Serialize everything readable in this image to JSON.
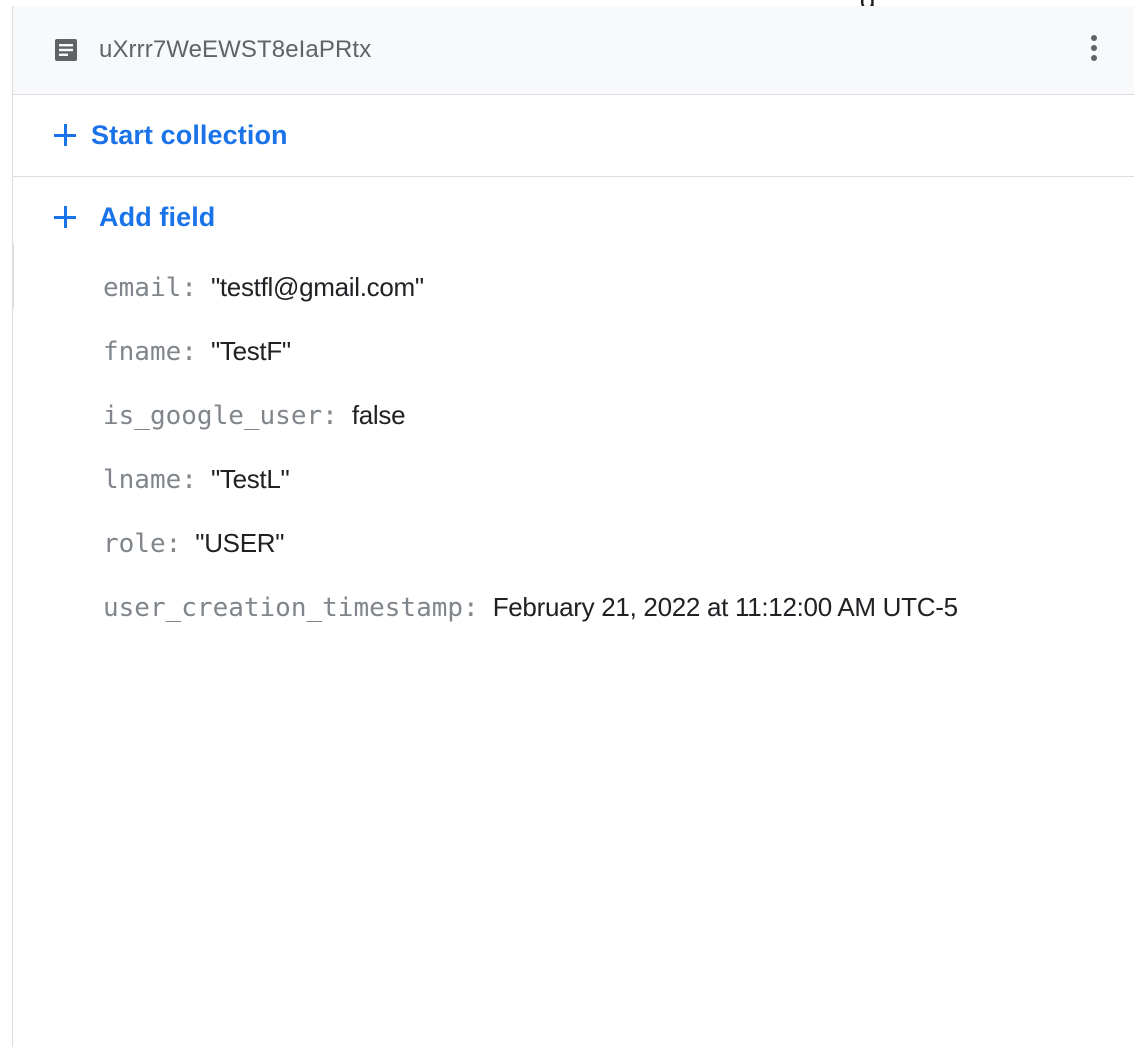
{
  "document": {
    "id": "uXrrr7WeEWST8eIaPRtx"
  },
  "actions": {
    "start_collection": "Start collection",
    "add_field": "Add field"
  },
  "fields": [
    {
      "key": "email",
      "value": "\"testfl@gmail.com\""
    },
    {
      "key": "fname",
      "value": "\"TestF\""
    },
    {
      "key": "is_google_user",
      "value": "false"
    },
    {
      "key": "lname",
      "value": "\"TestL\""
    },
    {
      "key": "role",
      "value": "\"USER\""
    },
    {
      "key": "user_creation_timestamp",
      "value": "February 21, 2022 at 11:12:00 AM UTC-5"
    }
  ],
  "top_right_fragment": "g",
  "colors": {
    "accent": "#1a73e8",
    "header_bg": "#f8f9fa",
    "border": "#dadce0",
    "key_text": "#80868b",
    "value_text": "#202124"
  },
  "icons": {
    "document": "document-icon",
    "more": "more-vert-icon",
    "plus": "plus-icon"
  }
}
